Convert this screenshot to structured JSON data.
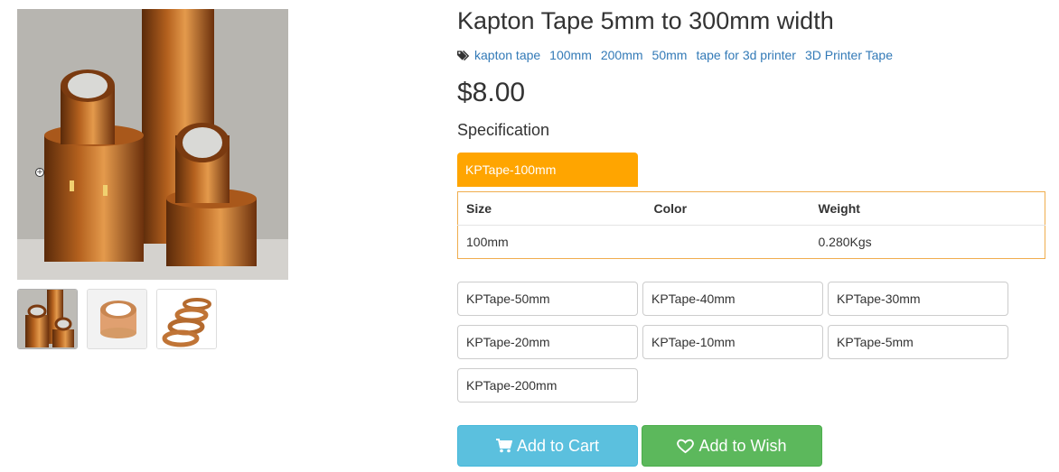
{
  "product": {
    "title": "Kapton Tape 5mm to 300mm width",
    "price": "$8.00",
    "tags": [
      "kapton tape",
      "100mm",
      "200mm",
      "50mm",
      "tape for 3d printer",
      "3D Printer Tape"
    ]
  },
  "gallery": {
    "zoom_icon": "zoom-in-icon",
    "thumbnail_count": 3
  },
  "specification": {
    "label": "Specification",
    "selected": "KPTape-100mm",
    "table_headers": [
      "Size",
      "Color",
      "Weight"
    ],
    "table_row": [
      "100mm",
      "",
      "0.280Kgs"
    ],
    "options": [
      "KPTape-50mm",
      "KPTape-40mm",
      "KPTape-30mm",
      "KPTape-20mm",
      "KPTape-10mm",
      "KPTape-5mm",
      "KPTape-200mm"
    ]
  },
  "actions": {
    "add_to_cart": "Add to Cart",
    "add_to_wish": "Add to Wish",
    "cart_icon": "shopping-cart-icon",
    "wish_icon": "heart-icon"
  },
  "colors": {
    "accent_orange": "#ffa500",
    "link_blue": "#337ab7",
    "cart_blue": "#5bc0de",
    "wish_green": "#5cb85c"
  }
}
